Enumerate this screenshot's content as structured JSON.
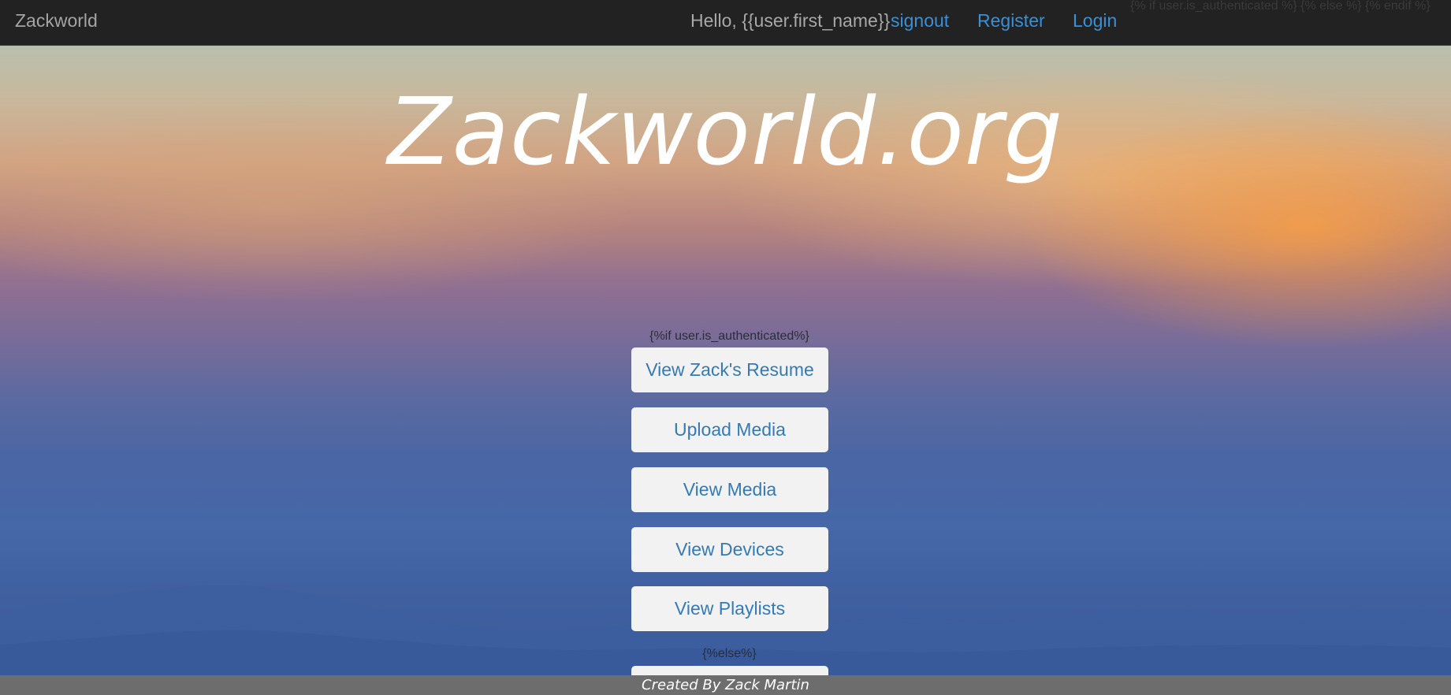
{
  "navbar": {
    "brand": "Zackworld",
    "greeting": "Hello, {{user.first_name}}",
    "signout_label": "signout",
    "register_label": "Register",
    "login_label": "Login",
    "template_text": "{% if user.is_authenticated %} {% else %} {% endif %}"
  },
  "hero": {
    "title": "Zackworld.org",
    "template_if": "{%if user.is_authenticated%}",
    "template_else": "{%else%}",
    "buttons": [
      {
        "label": "View Zack's Resume"
      },
      {
        "label": "Upload Media"
      },
      {
        "label": "View Media"
      },
      {
        "label": "View Devices"
      },
      {
        "label": "View Playlists"
      },
      {
        "label": ""
      }
    ]
  },
  "footer": {
    "credit": "Created By Zack Martin"
  },
  "colors": {
    "navbar_bg": "#222222",
    "link": "#337ab7",
    "footer_bg": "#6d6d6d"
  }
}
